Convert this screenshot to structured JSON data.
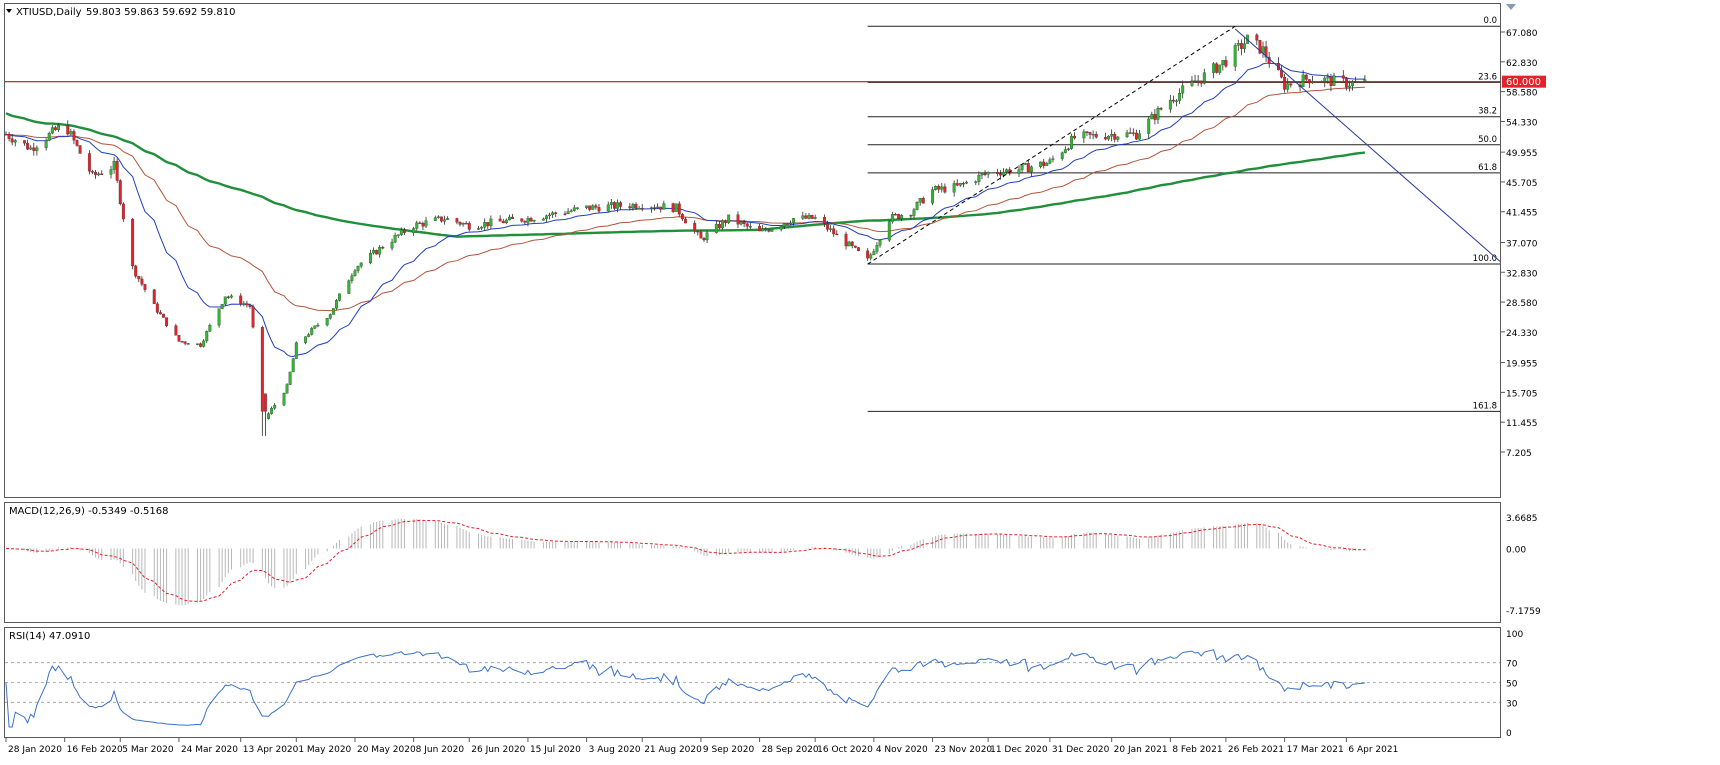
{
  "header": {
    "symbol_label": "XTIUSD,Daily",
    "ohlc": "59.803 59.863 59.692 59.810",
    "macd_label": "MACD(12,26,9) -0.5349 -0.5168",
    "rsi_label": "RSI(14) 47.0910"
  },
  "colors": {
    "bull_candle": "#2fb82f",
    "bear_candle": "#e3222a",
    "ma_fast": "#1f3fbf",
    "ma_mid": "#b5543c",
    "ma_slow": "#1f8f3a",
    "resistance_line": "#b01818",
    "price_badge": "#e3222a",
    "rsi_line": "#3a72c8",
    "macd_signal": "#e3222a",
    "macd_hist": "#b8b8b8"
  },
  "chart_data": [
    {
      "type": "candlestick",
      "title": "XTIUSD,Daily",
      "price_range": [
        7.205,
        70.0
      ],
      "y_ticks": [
        "67.080",
        "62.830",
        "58.580",
        "54.330",
        "49.955",
        "45.705",
        "41.455",
        "37.070",
        "32.830",
        "28.580",
        "24.330",
        "19.955",
        "15.705",
        "11.455",
        "7.205"
      ],
      "x_ticks": [
        "28 Jan 2020",
        "16 Feb 2020",
        "5 Mar 2020",
        "24 Mar 2020",
        "13 Apr 2020",
        "1 May 2020",
        "20 May 2020",
        "8 Jun 2020",
        "26 Jun 2020",
        "15 Jul 2020",
        "3 Aug 2020",
        "21 Aug 2020",
        "9 Sep 2020",
        "28 Sep 2020",
        "16 Oct 2020",
        "4 Nov 2020",
        "23 Nov 2020",
        "11 Dec 2020",
        "31 Dec 2020",
        "20 Jan 2021",
        "8 Feb 2021",
        "26 Feb 2021",
        "17 Mar 2021",
        "6 Apr 2021"
      ],
      "close_series": [
        [
          "28 Jan 2020",
          52.5
        ],
        [
          "5 Feb 2020",
          50.5
        ],
        [
          "16 Feb 2020",
          54.0
        ],
        [
          "25 Feb 2020",
          46.5
        ],
        [
          "3 Mar 2020",
          48.0
        ],
        [
          "9 Mar 2020",
          33.5
        ],
        [
          "16 Mar 2020",
          28.0
        ],
        [
          "24 Mar 2020",
          23.0
        ],
        [
          "31 Mar 2020",
          22.5
        ],
        [
          "8 Apr 2020",
          29.5
        ],
        [
          "16 Apr 2020",
          28.0
        ],
        [
          "21 Apr 2020",
          12.0
        ],
        [
          "28 Apr 2020",
          16.5
        ],
        [
          "1 May 2020",
          22.5
        ],
        [
          "12 May 2020",
          27.0
        ],
        [
          "20 May 2020",
          33.5
        ],
        [
          "1 Jun 2020",
          37.5
        ],
        [
          "8 Jun 2020",
          39.5
        ],
        [
          "18 Jun 2020",
          40.5
        ],
        [
          "26 Jun 2020",
          39.5
        ],
        [
          "15 Jul 2020",
          40.5
        ],
        [
          "3 Aug 2020",
          42.0
        ],
        [
          "21 Aug 2020",
          42.5
        ],
        [
          "1 Sep 2020",
          42.0
        ],
        [
          "9 Sep 2020",
          37.5
        ],
        [
          "18 Sep 2020",
          40.5
        ],
        [
          "28 Sep 2020",
          38.5
        ],
        [
          "9 Oct 2020",
          40.5
        ],
        [
          "16 Oct 2020",
          40.5
        ],
        [
          "26 Oct 2020",
          37.0
        ],
        [
          "2 Nov 2020",
          34.5
        ],
        [
          "9 Nov 2020",
          40.5
        ],
        [
          "16 Nov 2020",
          41.5
        ],
        [
          "23 Nov 2020",
          44.5
        ],
        [
          "1 Dec 2020",
          45.0
        ],
        [
          "11 Dec 2020",
          47.0
        ],
        [
          "21 Dec 2020",
          47.5
        ],
        [
          "31 Dec 2020",
          48.5
        ],
        [
          "8 Jan 2021",
          52.0
        ],
        [
          "20 Jan 2021",
          52.5
        ],
        [
          "28 Jan 2021",
          52.5
        ],
        [
          "8 Feb 2021",
          57.5
        ],
        [
          "18 Feb 2021",
          60.5
        ],
        [
          "26 Feb 2021",
          63.0
        ],
        [
          "5 Mar 2021",
          66.0
        ],
        [
          "10 Mar 2021",
          64.5
        ],
        [
          "17 Mar 2021",
          59.5
        ],
        [
          "25 Mar 2021",
          60.5
        ],
        [
          "6 Apr 2021",
          59.8
        ]
      ],
      "fibonacci": {
        "low": 34.0,
        "high": 67.9,
        "levels": [
          {
            "label": "0.0",
            "price": 67.9
          },
          {
            "label": "23.6",
            "price": 59.9
          },
          {
            "label": "38.2",
            "price": 55.0
          },
          {
            "label": "50.0",
            "price": 51.0
          },
          {
            "label": "61.8",
            "price": 47.0
          },
          {
            "label": "100.0",
            "price": 34.0
          },
          {
            "label": "161.8",
            "price": 13.0
          }
        ]
      },
      "horizontal_line": {
        "price": 60.0,
        "label": "60.000"
      },
      "trendline": [
        [
          "1 Mar 2021",
          67.5
        ],
        [
          "14 Apr 2021",
          50.5
        ]
      ]
    },
    {
      "type": "line",
      "title": "MACD(12,26,9) -0.5349 -0.5168",
      "y_ticks": [
        "3.6685",
        "0.00",
        "-7.1759"
      ],
      "y_range": [
        -7.1759,
        3.6685
      ]
    },
    {
      "type": "line",
      "title": "RSI(14) 47.0910",
      "y_ticks": [
        "100",
        "70",
        "50",
        "30",
        "0"
      ],
      "y_range": [
        0,
        100
      ],
      "levels": [
        70,
        50,
        30
      ]
    }
  ]
}
